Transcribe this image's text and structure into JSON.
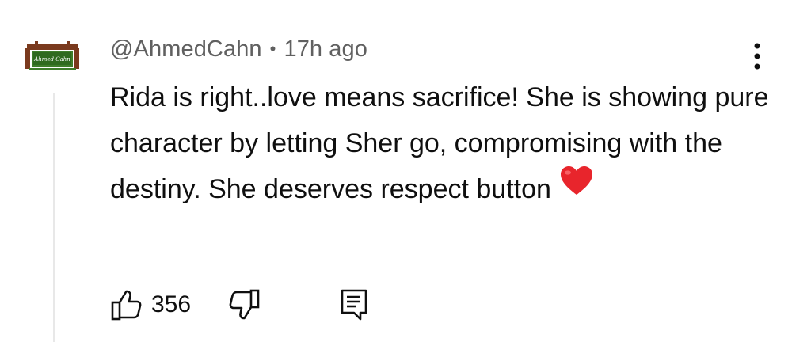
{
  "comment": {
    "author": "@AhmedCahn",
    "separator": "•",
    "time": "17h ago",
    "text": "Rida is right..love means sacrifice! She is showing pure character by letting Sher go, compromising with the destiny. She deserves respect button",
    "emoji": "red-heart-icon",
    "likes": "356",
    "avatar_text": "Ahmed Cahn"
  },
  "icons": {
    "menu": "vertical-ellipsis-icon",
    "like": "thumbs-up-icon",
    "dislike": "thumbs-down-icon",
    "reply": "reply-comment-icon"
  },
  "colors": {
    "meta_text": "#606060",
    "body_text": "#0f0f0f",
    "heart": "#e8252c",
    "avatar_bg": "#7a3a1e",
    "avatar_green": "#3e7d2a"
  }
}
